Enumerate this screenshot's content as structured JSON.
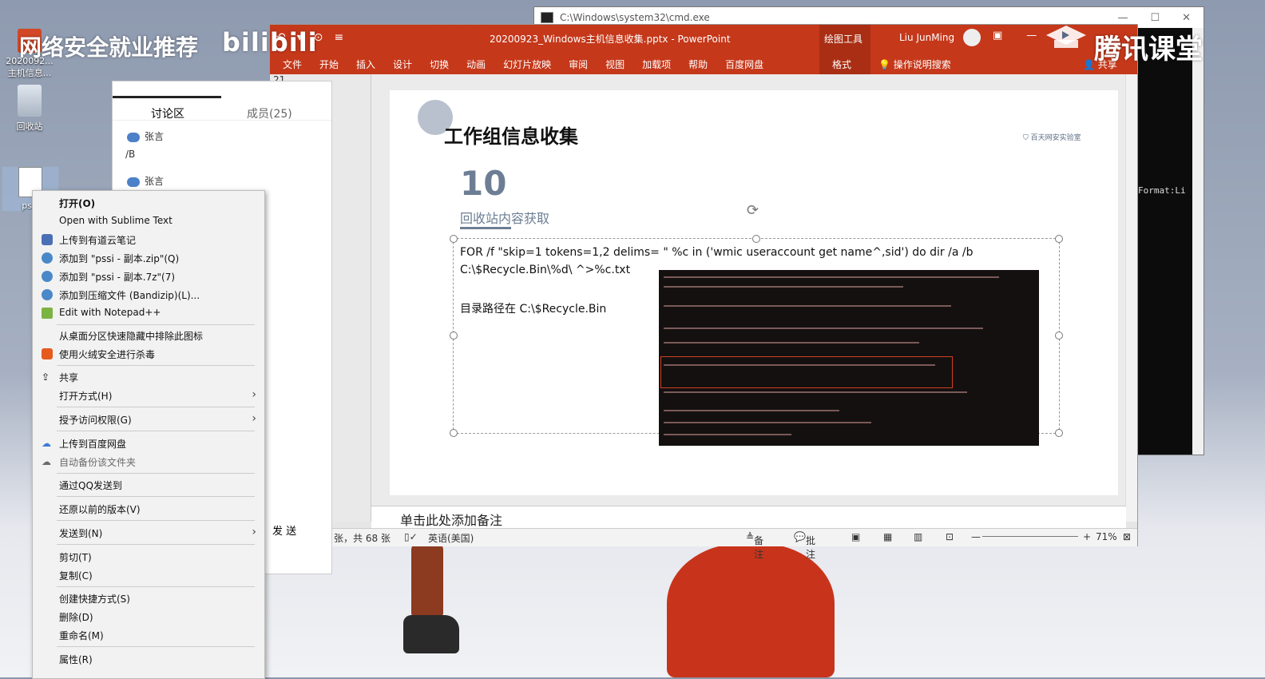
{
  "watermark": {
    "left_text": "网络安全就业推荐",
    "bili": "bilibili",
    "right_text": "腾讯课堂"
  },
  "desktop": {
    "icons": [
      {
        "label": "2020092...主机信息..."
      },
      {
        "label": "回收站"
      },
      {
        "label": "pssi"
      }
    ]
  },
  "cmd": {
    "title": "C:\\Windows\\system32\\cmd.exe",
    "output_fragment": "Format:Li"
  },
  "ppt": {
    "doc_title": "20200923_Windows主机信息收集.pptx - PowerPoint",
    "drawing_tools": "绘图工具",
    "user": "Liu JunMing",
    "menu": [
      "文件",
      "开始",
      "插入",
      "设计",
      "切换",
      "动画",
      "幻灯片放映",
      "审阅",
      "视图",
      "加载项",
      "帮助",
      "百度网盘"
    ],
    "format_tab": "格式",
    "tell_me": "操作说明搜索",
    "share": "共享",
    "thumb_number": "21",
    "slide": {
      "title": "工作组信息收集",
      "logo_text": "百天网安实验室",
      "number": "10",
      "subtitle": "回收站内容获取",
      "code_line1": "FOR /f \"skip=1 tokens=1,2 delims= \" %c in ('wmic useraccount get name^,sid') do dir /a /b",
      "code_line2": "C:\\$Recycle.Bin\\%d\\ ^>%c.txt",
      "path_line": "目录路径在 C:\\$Recycle.Bin"
    },
    "notes_placeholder": "单击此处添加备注",
    "status": {
      "slide_info": "张，共 68 张",
      "language": "英语(美国)",
      "notes_btn": "备注",
      "comments_btn": "批注",
      "zoom": "71%"
    }
  },
  "chat": {
    "tab_discussion": "讨论区",
    "tab_members": "成员(25)",
    "messages": [
      {
        "name": "张言",
        "text": "/B"
      },
      {
        "name": "张言",
        "text": ""
      }
    ],
    "send": "发 送"
  },
  "context_menu": {
    "items": [
      {
        "label": "打开(O)"
      },
      {
        "label": "Open with Sublime Text"
      },
      {
        "label": "上传到有道云笔记"
      },
      {
        "label": "添加到 \"pssi - 副本.zip\"(Q)"
      },
      {
        "label": "添加到 \"pssi - 副本.7z\"(7)"
      },
      {
        "label": "添加到压缩文件 (Bandizip)(L)..."
      },
      {
        "label": "Edit with Notepad++"
      },
      {
        "label": "从桌面分区快速隐藏中排除此图标"
      },
      {
        "label": "使用火绒安全进行杀毒"
      },
      {
        "label": "共享"
      },
      {
        "label": "打开方式(H)"
      },
      {
        "label": "授予访问权限(G)"
      },
      {
        "label": "上传到百度网盘"
      },
      {
        "label": "自动备份该文件夹"
      },
      {
        "label": "通过QQ发送到"
      },
      {
        "label": "还原以前的版本(V)"
      },
      {
        "label": "发送到(N)"
      },
      {
        "label": "剪切(T)"
      },
      {
        "label": "复制(C)"
      },
      {
        "label": "创建快捷方式(S)"
      },
      {
        "label": "删除(D)"
      },
      {
        "label": "重命名(M)"
      },
      {
        "label": "属性(R)"
      }
    ]
  },
  "colors": {
    "ppt_ribbon": "#c5381a",
    "slide_accent": "#6d7e94"
  }
}
